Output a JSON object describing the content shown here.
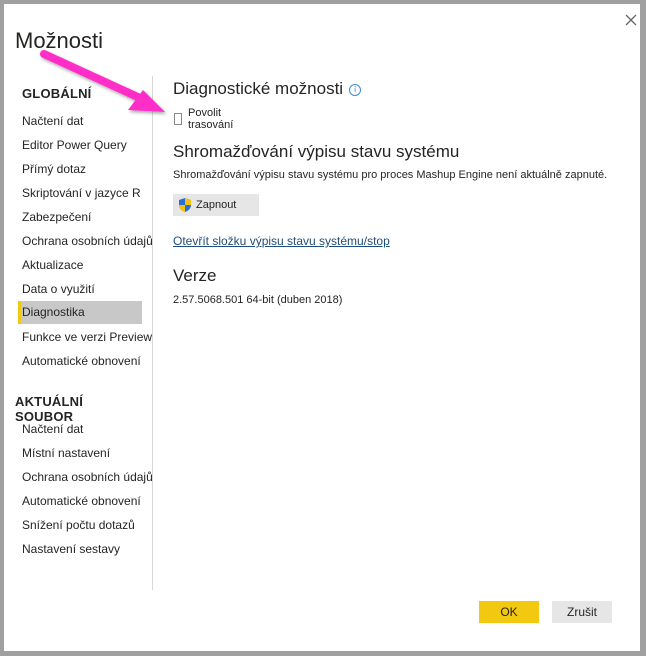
{
  "dialog": {
    "title": "Možnosti",
    "close_icon": "close-icon"
  },
  "sidebar": {
    "global_header": "GLOBÁLNÍ",
    "global_items": [
      {
        "label": "Načtení dat",
        "selected": false
      },
      {
        "label": "Editor Power Query",
        "selected": false
      },
      {
        "label": "Přímý dotaz",
        "selected": false
      },
      {
        "label": "Skriptování v jazyce R",
        "selected": false
      },
      {
        "label": "Zabezpečení",
        "selected": false
      },
      {
        "label": "Ochrana osobních údajů",
        "selected": false
      },
      {
        "label": "Aktualizace",
        "selected": false
      },
      {
        "label": "Data o využití",
        "selected": false
      },
      {
        "label": "Diagnostika",
        "selected": true
      },
      {
        "label": "Funkce ve verzi Preview",
        "selected": false
      },
      {
        "label": "Automatické obnovení",
        "selected": false
      }
    ],
    "file_header": "AKTUÁLNÍ SOUBOR",
    "file_items": [
      {
        "label": "Načtení dat"
      },
      {
        "label": "Místní nastavení"
      },
      {
        "label": "Ochrana osobních údajů"
      },
      {
        "label": "Automatické obnovení"
      },
      {
        "label": "Snížení počtu dotazů"
      },
      {
        "label": "Nastavení sestavy"
      }
    ]
  },
  "content": {
    "diag_title": "Diagnostické možnosti",
    "info_glyph": "i",
    "tracing_checkbox": {
      "label": "Povolit trasování",
      "checked": false
    },
    "dump_title": "Shromažďování výpisu stavu systému",
    "dump_desc": "Shromažďování výpisu stavu systému pro proces Mashup Engine není aktuálně zapnuté.",
    "enable_button": "Zapnout",
    "open_folder_link": "Otevřít složku výpisu stavu systému/stop",
    "version_title": "Verze",
    "version_value": "2.57.5068.501 64-bit (duben 2018)"
  },
  "footer": {
    "ok_label": "OK",
    "cancel_label": "Zrušit"
  },
  "colors": {
    "accent": "#f2c811",
    "annotation_arrow": "#ff2fc8",
    "link": "#1f4e79"
  }
}
